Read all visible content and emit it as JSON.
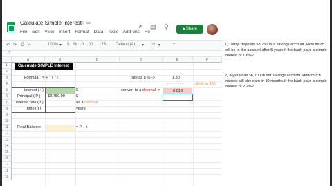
{
  "window": {
    "doc_title": "Calculate Simple Interest",
    "menu": [
      "File",
      "Edit",
      "View",
      "Insert",
      "Format",
      "Data",
      "Tools",
      "Add-ons",
      "He"
    ],
    "share_label": "Share"
  },
  "toolbar": {
    "zoom": "100%",
    "currency": "$",
    "percent": "%",
    "decimals_a": ".0",
    ".00": ".00",
    "format_123": "123",
    "font": "Default (Ari...",
    "size": "10"
  },
  "columns": [
    "A",
    "B",
    "C",
    "D",
    "E",
    "F"
  ],
  "rows": [
    "1",
    "2",
    "3",
    "4",
    "5",
    "6",
    "7",
    "8",
    "9",
    "10",
    "11",
    "12",
    "13",
    "14",
    "15",
    "16",
    "17",
    "18",
    "19"
  ],
  "sheet": {
    "title": "Calculate SIMPLE Interest",
    "formula": "Formula:  i = P * r * t",
    "labels": {
      "interest": "interest ( i )",
      "principal": "Principal ( P )",
      "rate": "interest rate ( r )",
      "time": "time ( t )"
    },
    "principal_value": "$3,750.00",
    "dollar_1": "$",
    "dollar_2": "$",
    "as_decimal_prefix": "as a ",
    "as_decimal_word": "decimal",
    "years": "years",
    "final_balance": "Final Balance:",
    "final_formula": "= P + i",
    "rate_pct_label": "rate as a %  ->",
    "rate_pct_value": "1.80",
    "placeholder_x": "x x x x x x x x",
    "divide_label": "divide by 100",
    "convert_prefix": "convert to a ",
    "convert_word": "decimal",
    "convert_arrow": " ->",
    "decimal_value": "0.018"
  },
  "questions": {
    "q1": "1)   Darryl deposits $3,750 in a savings account. How much will be in the account after 5 years if the bank pays a simple interest of 1.8%?",
    "q2": "2)   Alyssa has $6,200 in her savings account. How much interest will she earn in 30 months if the bank pays a simple interest of 2.2%?"
  }
}
